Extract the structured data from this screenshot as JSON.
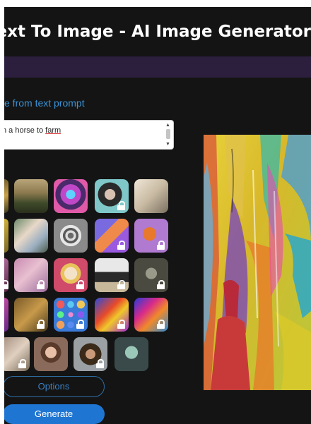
{
  "app": {
    "title": "Text To Image - AI Image Generator",
    "subtitle": "e from text prompt"
  },
  "prompt": {
    "value_prefix": "n a horse to ",
    "value_underlined": "farm"
  },
  "buttons": {
    "options_label": "Options",
    "generate_label": "Generate"
  },
  "style_tiles": [
    {
      "id": "r0c0",
      "locked": false
    },
    {
      "id": "r0c1",
      "locked": false
    },
    {
      "id": "r0c2",
      "locked": false
    },
    {
      "id": "r0c3",
      "locked": true
    },
    {
      "id": "r0c4",
      "locked": false
    },
    {
      "id": "r1c0",
      "locked": false
    },
    {
      "id": "r1c1",
      "locked": false
    },
    {
      "id": "r1c2",
      "locked": false
    },
    {
      "id": "r1c3",
      "locked": true
    },
    {
      "id": "r1c4",
      "locked": true
    },
    {
      "id": "r2c0",
      "locked": true
    },
    {
      "id": "r2c1",
      "locked": true
    },
    {
      "id": "r2c2",
      "locked": true
    },
    {
      "id": "r2c3",
      "locked": true
    },
    {
      "id": "r2c4",
      "locked": true
    },
    {
      "id": "r3c0",
      "locked": true
    },
    {
      "id": "r3c1",
      "locked": true
    },
    {
      "id": "r3c2",
      "locked": true
    },
    {
      "id": "r3c3",
      "locked": true
    },
    {
      "id": "r3c4",
      "locked": true
    },
    {
      "id": "r4c0",
      "locked": true
    },
    {
      "id": "r4c1",
      "locked": false
    },
    {
      "id": "r4c2",
      "locked": true
    },
    {
      "id": "r4c3",
      "locked": false
    }
  ],
  "colors": {
    "background": "#141414",
    "accent": "#1f76d2",
    "link": "#3a93d6",
    "band": "#2b1f3d"
  }
}
